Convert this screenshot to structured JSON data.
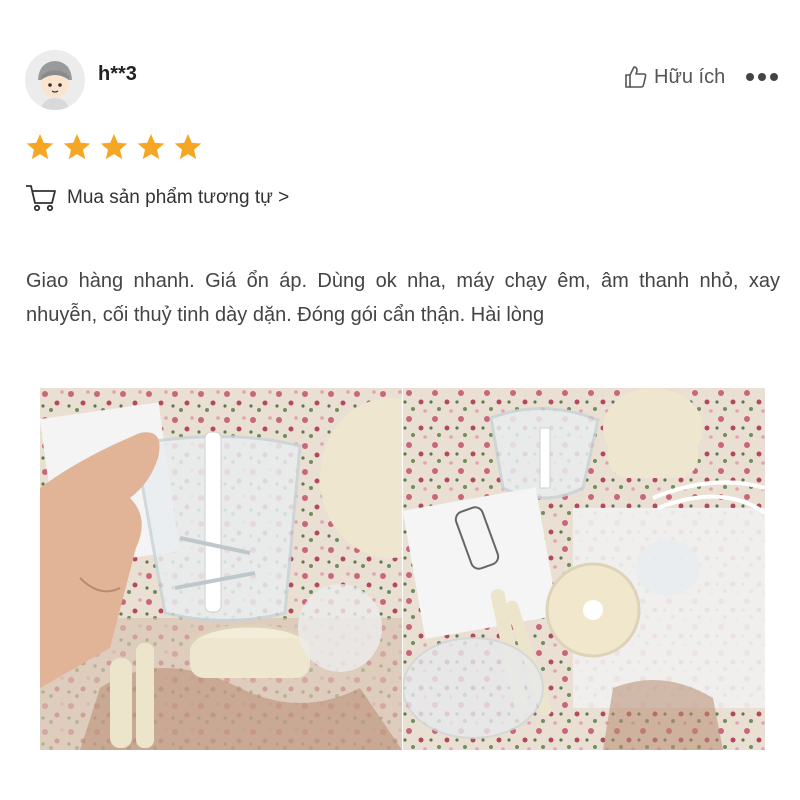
{
  "review": {
    "username": "h**3",
    "helpful_label": "Hữu ích",
    "rating": 5,
    "max_rating": 5,
    "buy_similar_label": "Mua sản phẩm tương tự >",
    "text": "Giao hàng nhanh. Giá ổn áp. Dùng ok nha, máy chạy êm, âm thanh nhỏ, xay nhuyễn, cối thuỷ tinh dày dặn. Đóng gói cẩn thận. Hài lòng"
  },
  "icons": {
    "avatar": "avatar-icon",
    "helpful": "thumbs-up-icon",
    "more": "more-dots-icon",
    "star": "star-icon",
    "cart": "shopping-cart-icon"
  },
  "colors": {
    "star": "#f5a623",
    "text": "#444444",
    "username": "#222222"
  },
  "photos": [
    {
      "name": "review-photo-1",
      "description": "Hand holding glass blender bowl"
    },
    {
      "name": "review-photo-2",
      "description": "Blender parts laid out on floral cloth"
    }
  ]
}
